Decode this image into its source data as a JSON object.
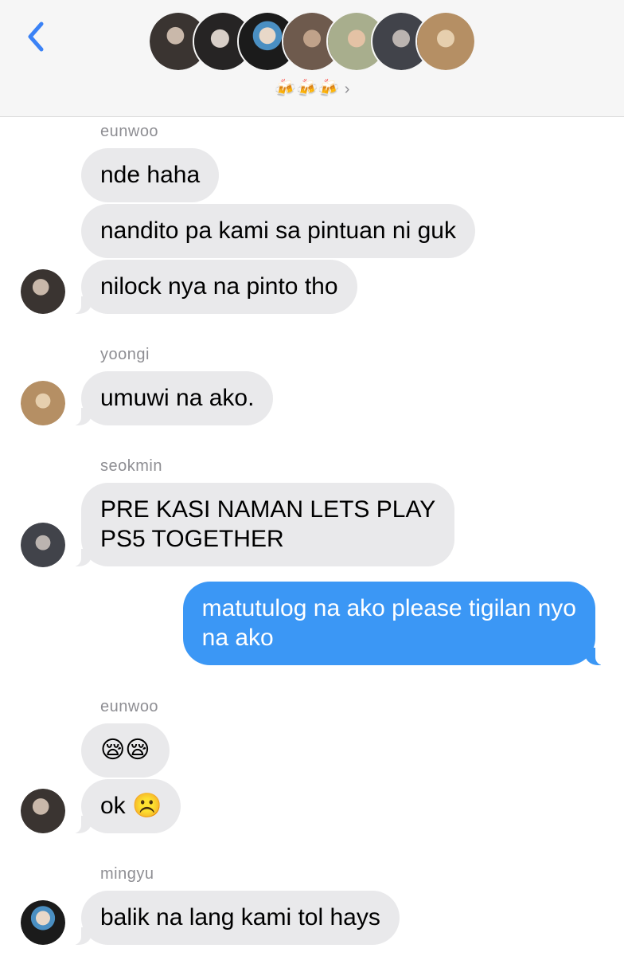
{
  "header": {
    "back_icon": "chevron-left-icon",
    "group_name": "🍻🍻🍻",
    "chevron": "›",
    "member_count": 7
  },
  "colors": {
    "accent": "#3b97f5",
    "incoming_bubble": "#e9e9eb",
    "sender_label": "#8e8e93"
  },
  "messages": [
    {
      "sender": "eunwoo",
      "text": "nde haha"
    },
    {
      "text": "nandito pa kami sa pintuan ni guk"
    },
    {
      "text": "nilock nya na pinto tho"
    },
    {
      "sender": "yoongi",
      "text": "umuwi na ako."
    },
    {
      "sender": "seokmin",
      "line1": "PRE KASI NAMAN LETS PLAY",
      "line2": "PS5 TOGETHER"
    },
    {
      "line1": "matutulog na ako please tigilan nyo",
      "line2": "na ako",
      "from_me": true
    },
    {
      "sender": "eunwoo",
      "text": "😪😪"
    },
    {
      "text": "ok ☹️"
    },
    {
      "sender": "mingyu",
      "text": "balik na lang kami tol hays"
    }
  ]
}
